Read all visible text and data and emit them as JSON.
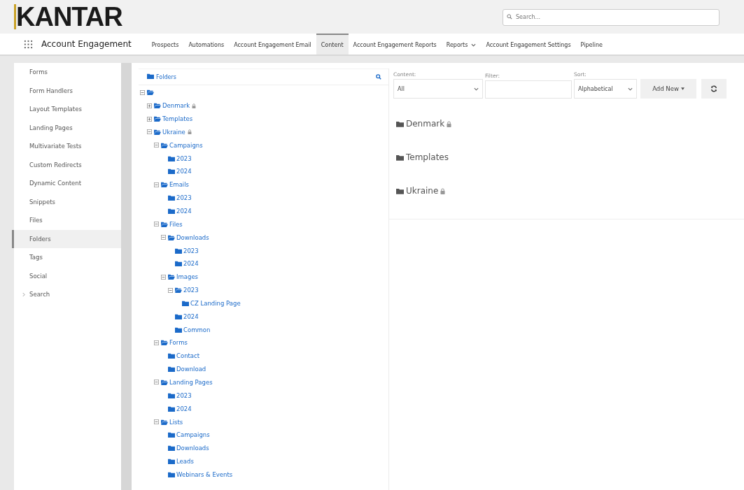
{
  "brand": {
    "logo": "KANTAR"
  },
  "search": {
    "placeholder": "Search..."
  },
  "nav": {
    "app_name": "Account Engagement",
    "tabs": [
      {
        "label": "Prospects",
        "selected": false,
        "dropdown": false
      },
      {
        "label": "Automations",
        "selected": false,
        "dropdown": false
      },
      {
        "label": "Account Engagement Email",
        "selected": false,
        "dropdown": false
      },
      {
        "label": "Content",
        "selected": true,
        "dropdown": false
      },
      {
        "label": "Account Engagement Reports",
        "selected": false,
        "dropdown": false
      },
      {
        "label": "Reports",
        "selected": false,
        "dropdown": true
      },
      {
        "label": "Account Engagement Settings",
        "selected": false,
        "dropdown": false
      },
      {
        "label": "Pipeline",
        "selected": false,
        "dropdown": false
      }
    ]
  },
  "sidebar": {
    "items": [
      {
        "label": "Forms",
        "selected": false,
        "kind": "link"
      },
      {
        "label": "Form Handlers",
        "selected": false,
        "kind": "link"
      },
      {
        "label": "Layout Templates",
        "selected": false,
        "kind": "link"
      },
      {
        "label": "Landing Pages",
        "selected": false,
        "kind": "link"
      },
      {
        "label": "Multivariate Tests",
        "selected": false,
        "kind": "link"
      },
      {
        "label": "Custom Redirects",
        "selected": false,
        "kind": "link"
      },
      {
        "label": "Dynamic Content",
        "selected": false,
        "kind": "link"
      },
      {
        "label": "Snippets",
        "selected": false,
        "kind": "link"
      },
      {
        "label": "Files",
        "selected": false,
        "kind": "link"
      },
      {
        "label": "Folders",
        "selected": true,
        "kind": "link"
      },
      {
        "label": "Tags",
        "selected": false,
        "kind": "link"
      },
      {
        "label": "Social",
        "selected": false,
        "kind": "link"
      },
      {
        "label": "Search",
        "selected": false,
        "kind": "group"
      }
    ]
  },
  "tree": {
    "title": "Folders",
    "root": {
      "expanded": true,
      "children": [
        {
          "label": "Denmark",
          "locked": true,
          "expanded": false
        },
        {
          "label": "Templates",
          "locked": false,
          "expanded": false
        },
        {
          "label": "Ukraine",
          "locked": true,
          "expanded": true,
          "children": [
            {
              "label": "Campaigns",
              "locked": false,
              "expanded": true,
              "children": [
                {
                  "label": "2023",
                  "locked": false
                },
                {
                  "label": "2024",
                  "locked": false
                }
              ]
            },
            {
              "label": "Emails",
              "locked": false,
              "expanded": true,
              "children": [
                {
                  "label": "2023",
                  "locked": false
                },
                {
                  "label": "2024",
                  "locked": false
                }
              ]
            },
            {
              "label": "Files",
              "locked": false,
              "expanded": true,
              "children": [
                {
                  "label": "Downloads",
                  "locked": false,
                  "expanded": true,
                  "children": [
                    {
                      "label": "2023",
                      "locked": false
                    },
                    {
                      "label": "2024",
                      "locked": false
                    }
                  ]
                },
                {
                  "label": "Images",
                  "locked": false,
                  "expanded": true,
                  "children": [
                    {
                      "label": "2023",
                      "locked": false,
                      "expanded": true,
                      "children": [
                        {
                          "label": "CZ Landing Page",
                          "locked": false
                        }
                      ]
                    },
                    {
                      "label": "2024",
                      "locked": false
                    },
                    {
                      "label": "Common",
                      "locked": false
                    }
                  ]
                }
              ]
            },
            {
              "label": "Forms",
              "locked": false,
              "expanded": true,
              "children": [
                {
                  "label": "Contact",
                  "locked": false
                },
                {
                  "label": "Download",
                  "locked": false
                }
              ]
            },
            {
              "label": "Landing Pages",
              "locked": false,
              "expanded": true,
              "children": [
                {
                  "label": "2023",
                  "locked": false
                },
                {
                  "label": "2024",
                  "locked": false
                }
              ]
            },
            {
              "label": "Lists",
              "locked": false,
              "expanded": true,
              "children": [
                {
                  "label": "Campaigns",
                  "locked": false
                },
                {
                  "label": "Downloads",
                  "locked": false
                },
                {
                  "label": "Leads",
                  "locked": false
                },
                {
                  "label": "Webinars & Events",
                  "locked": false
                }
              ]
            }
          ]
        }
      ]
    }
  },
  "filters": {
    "content": {
      "label": "Content:",
      "value": "All"
    },
    "filter": {
      "label": "Filter:"
    },
    "sort": {
      "label": "Sort:",
      "value": "Alphabetical"
    },
    "add_button": "Add New"
  },
  "folders": [
    {
      "label": "Denmark",
      "locked": true
    },
    {
      "label": "Templates",
      "locked": false
    },
    {
      "label": "Ukraine",
      "locked": true
    }
  ]
}
